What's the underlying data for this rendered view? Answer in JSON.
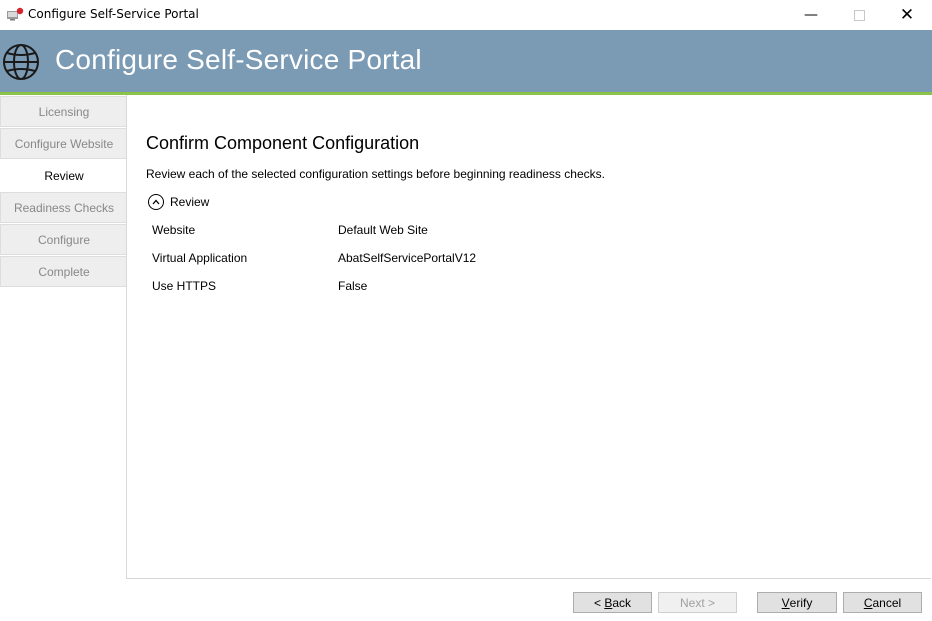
{
  "window": {
    "title": "Configure Self-Service Portal",
    "controls": [
      "minimize",
      "maximize",
      "close"
    ]
  },
  "banner": {
    "title": "Configure Self-Service Portal",
    "icon": "globe-icon",
    "accent_color": "#7b9ab4",
    "underline_color": "#8bc34a"
  },
  "nav": {
    "items": [
      {
        "label": "Licensing",
        "state": "inactive"
      },
      {
        "label": "Configure Website",
        "state": "inactive"
      },
      {
        "label": "Review",
        "state": "active"
      },
      {
        "label": "Readiness Checks",
        "state": "inactive"
      },
      {
        "label": "Configure",
        "state": "inactive"
      },
      {
        "label": "Complete",
        "state": "inactive"
      }
    ]
  },
  "main": {
    "heading": "Confirm Component Configuration",
    "description": "Review each of the selected configuration settings before beginning readiness checks.",
    "review": {
      "label": "Review",
      "expanded": true,
      "rows": [
        {
          "key": "Website",
          "value": "Default Web Site"
        },
        {
          "key": "Virtual Application",
          "value": "AbatSelfServicePortalV12"
        },
        {
          "key": "Use HTTPS",
          "value": "False"
        }
      ]
    }
  },
  "buttons": {
    "back": {
      "prefix": "< ",
      "accel": "B",
      "rest": "ack"
    },
    "next": {
      "label": "Next >",
      "enabled": false
    },
    "verify": {
      "accel": "V",
      "rest": "erify"
    },
    "cancel": {
      "accel": "C",
      "rest": "ancel"
    }
  }
}
